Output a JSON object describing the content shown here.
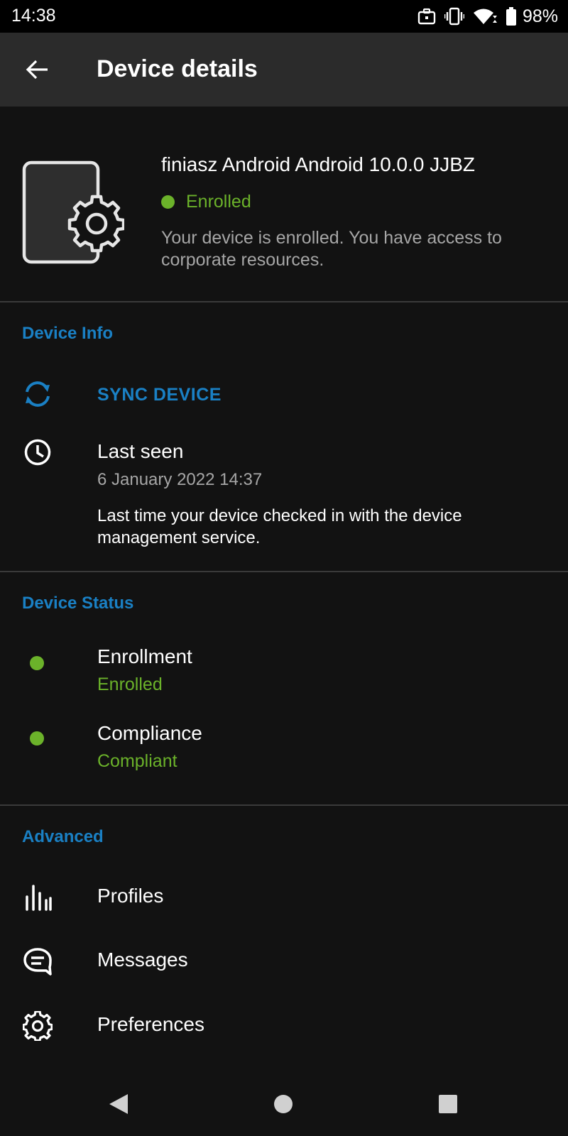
{
  "status_bar": {
    "time": "14:38",
    "battery_percent": "98%",
    "icons": [
      "work-profile-icon",
      "vibrate-icon",
      "wifi-icon",
      "battery-icon"
    ]
  },
  "app_bar": {
    "title": "Device details",
    "back_icon": "back-arrow-icon"
  },
  "device": {
    "name": "finiasz Android Android 10.0.0 JJBZ",
    "status": "Enrolled",
    "status_color": "#6bb22a",
    "description": "Your device is enrolled. You have access to corporate resources.",
    "illustration_icon": "device-settings-icon"
  },
  "device_info": {
    "title": "Device Info",
    "sync_label": "SYNC DEVICE",
    "last_seen_label": "Last seen",
    "last_seen_value": "6 January 2022 14:37",
    "last_seen_desc": "Last time your device checked in with the device management service."
  },
  "device_status": {
    "title": "Device Status",
    "items": [
      {
        "label": "Enrollment",
        "value": "Enrolled"
      },
      {
        "label": "Compliance",
        "value": "Compliant"
      }
    ]
  },
  "advanced": {
    "title": "Advanced",
    "items": [
      {
        "label": "Profiles",
        "icon": "profiles-icon"
      },
      {
        "label": "Messages",
        "icon": "messages-icon"
      },
      {
        "label": "Preferences",
        "icon": "gear-icon"
      }
    ]
  },
  "nav_bar": {
    "buttons": [
      "back-nav-icon",
      "home-nav-icon",
      "recents-nav-icon"
    ]
  },
  "colors": {
    "accent": "#1a80c4",
    "success": "#6bb22a",
    "background": "#121212",
    "app_bar": "#2b2b2b"
  }
}
